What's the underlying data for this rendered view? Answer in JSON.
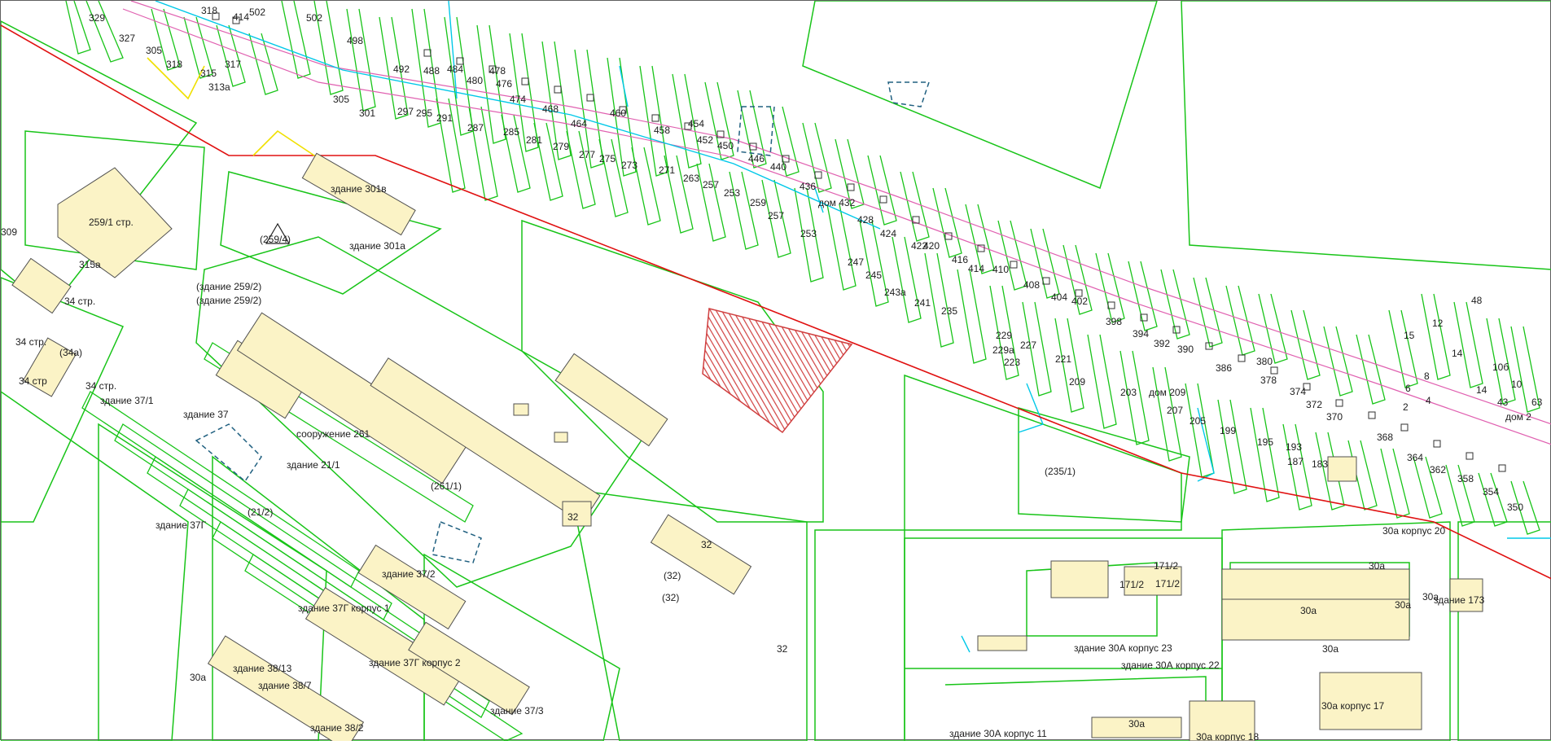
{
  "map": {
    "colors": {
      "parcel": "#18c418",
      "boundary_red": "#e01010",
      "road_magenta": "#e060b0",
      "water_cyan": "#00c8e8",
      "building_fill": "#fbf3c6",
      "building_stroke": "#505050",
      "yellow": "#f0e000",
      "selected_hatch": "#d04040",
      "dashed_blue": "#206080"
    },
    "labels": {
      "l329": "329",
      "l327": "327",
      "l318": "318",
      "l414": "414",
      "l502": "502",
      "l502b": "502",
      "l498": "498",
      "l305a": "305",
      "l318b": "318",
      "l315": "315",
      "l317": "317",
      "l313a": "313а",
      "l492": "492",
      "l488": "488",
      "l484": "484",
      "l480": "480",
      "l478": "478",
      "l476": "476",
      "l474": "474",
      "l468": "468",
      "l464": "464",
      "l460": "460",
      "l458": "458",
      "l454": "454",
      "l452": "452",
      "l450": "450",
      "l446": "446",
      "l440": "440",
      "l305": "305",
      "l301": "301",
      "l297": "297",
      "l295": "295",
      "l291": "291",
      "l287": "287",
      "l285": "285",
      "l281": "281",
      "l279": "279",
      "l277": "277",
      "l275": "275",
      "l273": "273",
      "l271": "271",
      "l263": "263",
      "l257": "257",
      "l253": "253",
      "l259": "259",
      "l257b": "257",
      "l253b": "253",
      "l247": "247",
      "l245": "245",
      "l243a": "243а",
      "l241": "241",
      "l235": "235",
      "l229": "229",
      "l229a": "229а",
      "l227": "227",
      "l223": "223",
      "l221": "221",
      "l209": "209",
      "l203": "203",
      "l207": "207",
      "l205": "205",
      "l199": "199",
      "l195": "195",
      "l193": "193",
      "l187": "187",
      "l183": "183",
      "l436": "436",
      "dom432": "дом 432",
      "l428": "428",
      "l424": "424",
      "l422": "422",
      "l420": "420",
      "l416": "416",
      "l414b": "414",
      "l410": "410",
      "l408": "408",
      "l404": "404",
      "l402": "402",
      "l398": "398",
      "l394": "394",
      "l392": "392",
      "l390": "390",
      "l386": "386",
      "l380": "380",
      "l378": "378",
      "l374": "374",
      "l372": "372",
      "l370": "370",
      "l368": "368",
      "l364": "364",
      "l362": "362",
      "l358": "358",
      "l354": "354",
      "l350": "350",
      "dom209": "дом 209",
      "l48": "48",
      "l12": "12",
      "l15": "15",
      "l14": "14",
      "l10b": "10б",
      "l10": "10",
      "l43": "43",
      "l8": "8",
      "l6": "6",
      "l4": "4",
      "l2": "2",
      "l63": "63",
      "dom2": "дом 2",
      "l14b": "14",
      "b301v": "здание 301в",
      "b301a": "здание 301а",
      "p259_4": "(259/4)",
      "b259_1": "259/1 стр.",
      "l315a": "315а",
      "l309": "309",
      "b259_2a": "(здание 259/2)",
      "b259_2b": "(здание 259/2)",
      "b34a": "34 стр.",
      "b34b": "34 стр.",
      "b34c": "34 стр",
      "b34d": "34 стр.",
      "p34a": "(34а)",
      "b37_1": "здание 37/1",
      "b37": "здание 37",
      "s261": "сооружение 261",
      "b21_1": "здание 21/1",
      "p261_1": "(261/1)",
      "p21_2": "(21/2)",
      "b37g": "здание 37Г",
      "b37_2": "здание 37/2",
      "b37g1": "здание 37Г корпус 1",
      "b37g2": "здание 37Г корпус 2",
      "b38_13": "здание 38/13",
      "b38_7": "здание 38/7",
      "b37_3": "здание 37/3",
      "b38_2": "здание 38/2",
      "l30a": "30а",
      "l32a": "32",
      "l32b": "32",
      "p32a": "(32)",
      "p32b": "(32)",
      "l32c": "32",
      "p235_1": "(235/1)",
      "b30a20": "30а корпус 20",
      "l171_2a": "171/2",
      "l171_2b": "171/2",
      "l171_2c": "171/2",
      "l30a_1": "30а",
      "l30a_2": "30а",
      "l30a_3": "30а",
      "l30a_4": "30а",
      "l30a_5": "30а",
      "b173": "здание 173",
      "b30A23": "здание 30А корпус 23",
      "b30A22": "здание 30А корпус 22",
      "b30a17": "30а корпус 17",
      "b30A11": "здание 30А корпус 11",
      "l30a_6": "30а",
      "b30a18": "30а корпус 18"
    }
  }
}
